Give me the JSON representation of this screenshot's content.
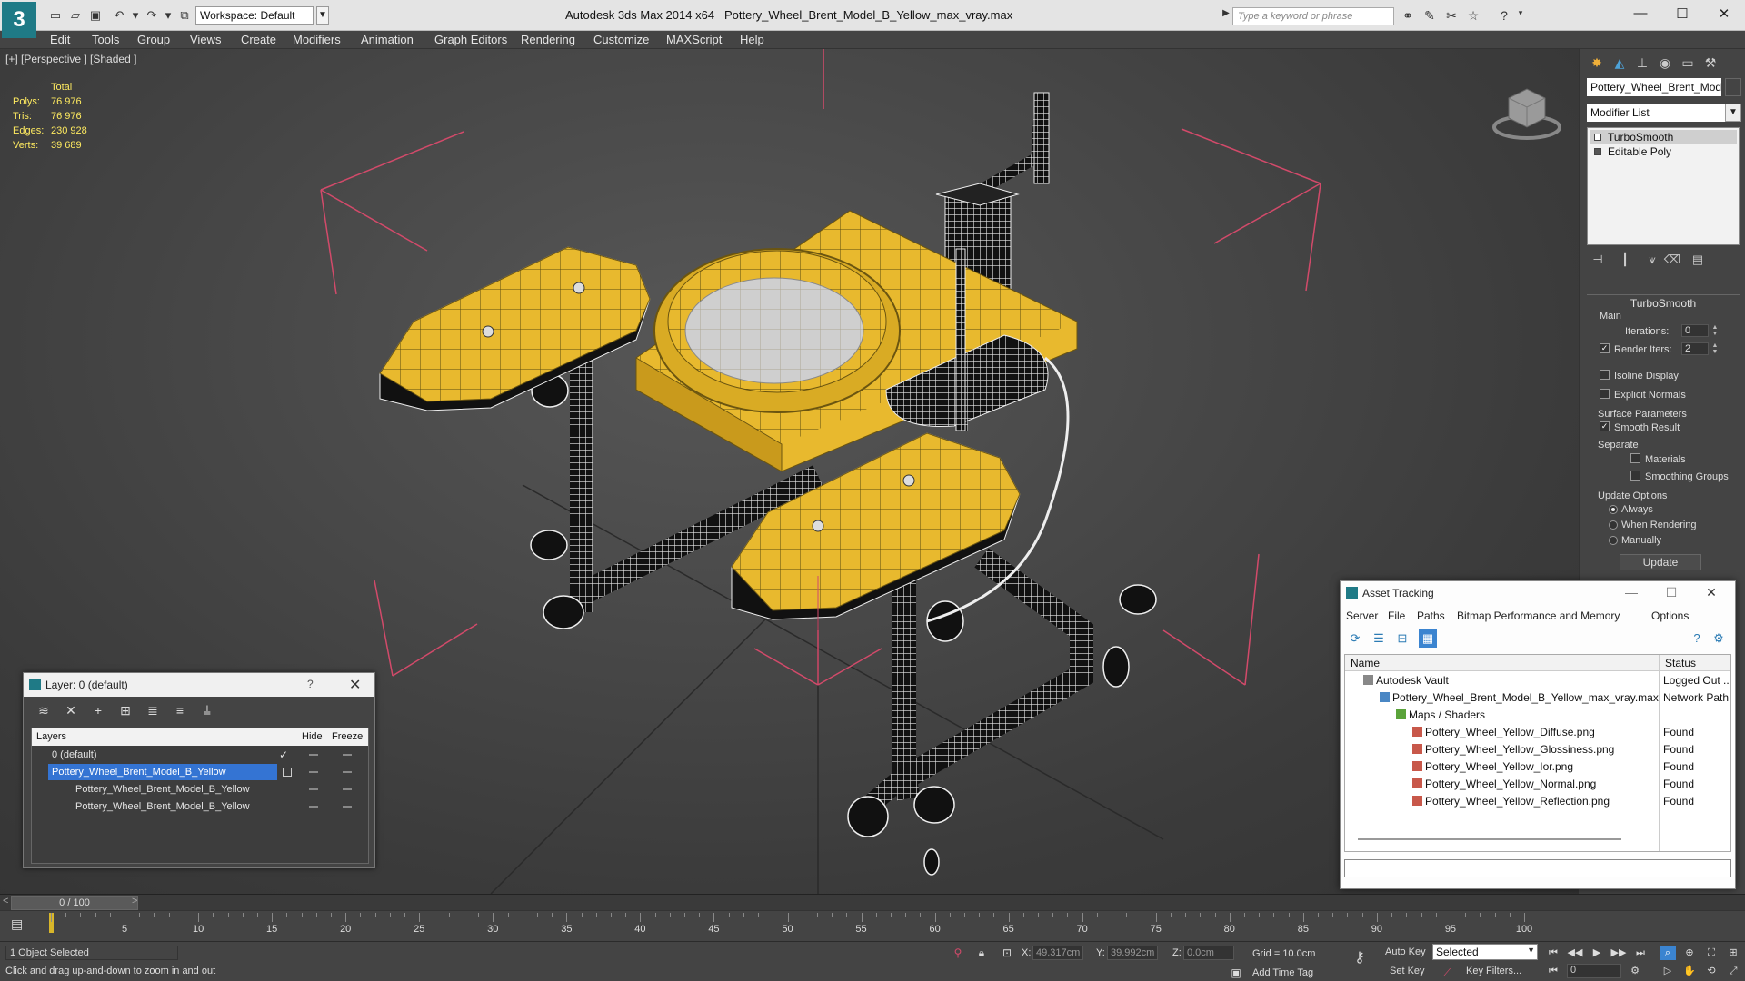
{
  "window": {
    "app_title": "Autodesk 3ds Max  2014 x64",
    "file_title": "Pottery_Wheel_Brent_Model_B_Yellow_max_vray.max",
    "workspace": "Workspace: Default",
    "search_placeholder": "Type a keyword or phrase",
    "minimize": "—",
    "maximize": "☐",
    "close": "✕"
  },
  "menu": [
    "Edit",
    "Tools",
    "Group",
    "Views",
    "Create",
    "Modifiers",
    "Animation",
    "Graph Editors",
    "Rendering",
    "Customize",
    "MAXScript",
    "Help"
  ],
  "viewport": {
    "label": "[+] [Perspective ] [Shaded ]",
    "stats": {
      "total_label": "Total",
      "rows": [
        {
          "key": "Polys:",
          "value": "76 976"
        },
        {
          "key": "Tris:",
          "value": "76 976"
        },
        {
          "key": "Edges:",
          "value": "230 928"
        },
        {
          "key": "Verts:",
          "value": "39 689"
        }
      ]
    }
  },
  "command_panel": {
    "object_name": "Pottery_Wheel_Brent_Model",
    "modifier_list": "Modifier List",
    "stack": [
      "TurboSmooth",
      "Editable Poly"
    ],
    "rollout_title": "TurboSmooth",
    "main_label": "Main",
    "iterations_label": "Iterations:",
    "iterations_value": "0",
    "render_iters_label": "Render Iters:",
    "render_iters_value": "2",
    "isoline_label": "Isoline Display",
    "explicit_normals_label": "Explicit Normals",
    "surface_params_label": "Surface Parameters",
    "smooth_result_label": "Smooth Result",
    "separate_label": "Separate",
    "materials_label": "Materials",
    "smoothing_groups_label": "Smoothing Groups",
    "update_options_label": "Update Options",
    "always_label": "Always",
    "when_rendering_label": "When Rendering",
    "manually_label": "Manually",
    "update_button": "Update"
  },
  "layer_window": {
    "title": "Layer: 0 (default)",
    "help": "?",
    "close": "✕",
    "col_layers": "Layers",
    "col_hide": "Hide",
    "col_freeze": "Freeze",
    "rows": [
      {
        "name": "0 (default)"
      },
      {
        "name": "Pottery_Wheel_Brent_Model_B_Yellow"
      },
      {
        "name": "Pottery_Wheel_Brent_Model_B_Yellow"
      },
      {
        "name": "Pottery_Wheel_Brent_Model_B_Yellow"
      }
    ]
  },
  "asset_tracking": {
    "title": "Asset Tracking",
    "menus": [
      "Server",
      "File",
      "Paths",
      "Bitmap Performance and Memory",
      "Options"
    ],
    "col_name": "Name",
    "col_status": "Status",
    "rows": [
      {
        "name": "Autodesk Vault",
        "status": "Logged Out ..."
      },
      {
        "name": "Pottery_Wheel_Brent_Model_B_Yellow_max_vray.max",
        "status": "Network Path"
      },
      {
        "name": "Maps / Shaders",
        "status": ""
      },
      {
        "name": "Pottery_Wheel_Yellow_Diffuse.png",
        "status": "Found"
      },
      {
        "name": "Pottery_Wheel_Yellow_Glossiness.png",
        "status": "Found"
      },
      {
        "name": "Pottery_Wheel_Yellow_Ior.png",
        "status": "Found"
      },
      {
        "name": "Pottery_Wheel_Yellow_Normal.png",
        "status": "Found"
      },
      {
        "name": "Pottery_Wheel_Yellow_Reflection.png",
        "status": "Found"
      }
    ]
  },
  "timeline": {
    "frame_display": "0 / 100",
    "ticks": [
      "5",
      "10",
      "15",
      "20",
      "25",
      "30",
      "35",
      "40",
      "45",
      "50",
      "55",
      "60",
      "65",
      "70",
      "75",
      "80",
      "85",
      "90",
      "95",
      "100"
    ]
  },
  "status": {
    "selection": "1 Object Selected",
    "hint": "Click and drag up-and-down to zoom in and out",
    "x_label": "X:",
    "x_value": "49.317cm",
    "y_label": "Y:",
    "y_value": "39.992cm",
    "z_label": "Z:",
    "z_value": "0.0cm",
    "grid": "Grid = 10.0cm",
    "add_time_tag": "Add Time Tag",
    "auto_key": "Auto Key",
    "set_key": "Set Key",
    "selected_dropdown": "Selected",
    "key_filters": "Key Filters...",
    "frame_value": "0"
  },
  "colors": {
    "model_yellow": "#e8b92e",
    "selection_blue": "#3474d3",
    "stats_yellow": "#ffeb60",
    "bbox_pink": "#d24a6a"
  }
}
